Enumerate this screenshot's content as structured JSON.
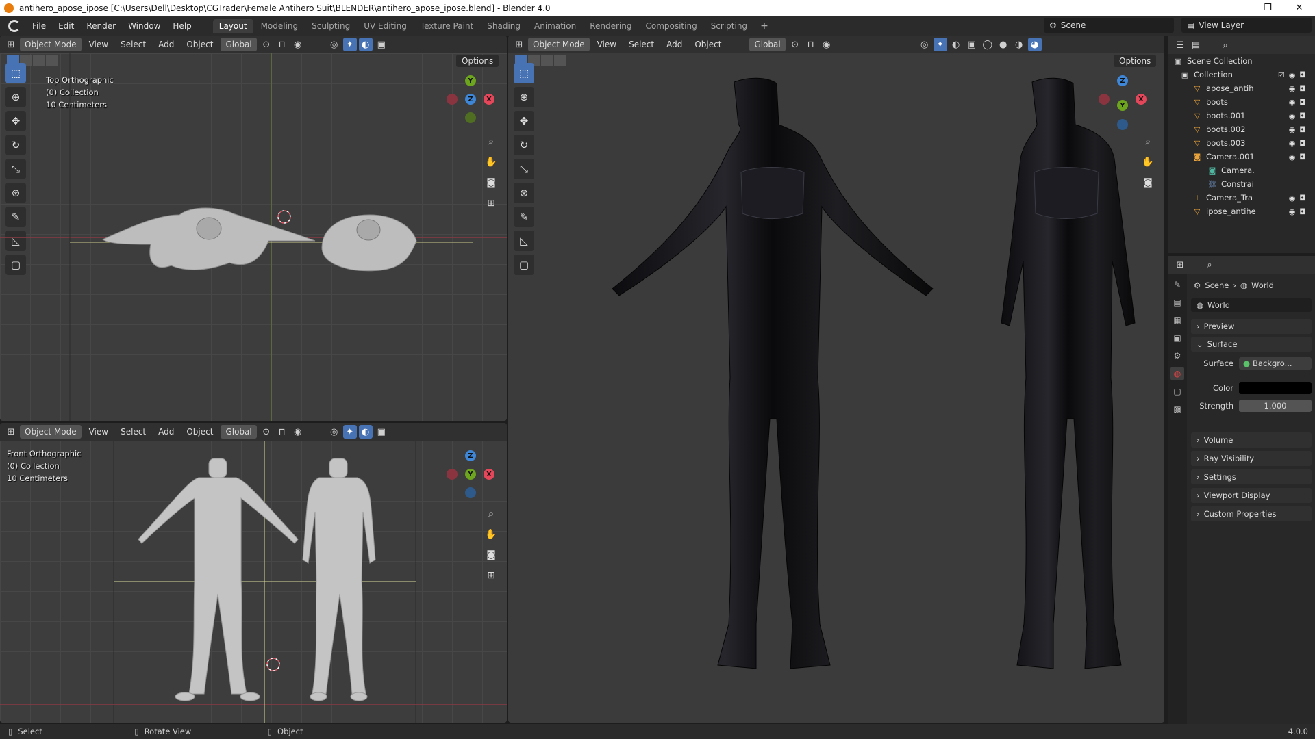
{
  "window": {
    "title": "antihero_apose_ipose [C:\\Users\\Dell\\Desktop\\CGTrader\\Female Antihero Suit\\BLENDER\\antihero_apose_ipose.blend] - Blender 4.0",
    "minimize": "—",
    "maximize": "❐",
    "close": "✕"
  },
  "menu": [
    "File",
    "Edit",
    "Render",
    "Window",
    "Help"
  ],
  "workspaces": [
    "Layout",
    "Modeling",
    "Sculpting",
    "UV Editing",
    "Texture Paint",
    "Shading",
    "Animation",
    "Rendering",
    "Compositing",
    "Scripting"
  ],
  "active_workspace": "Layout",
  "workspace_add": "+",
  "scene": "Scene",
  "view_layer": "View Layer",
  "viewport_header": {
    "mode": "Object Mode",
    "view": "View",
    "select": "Select",
    "add": "Add",
    "object": "Object",
    "orientation": "Global",
    "options": "Options"
  },
  "viewports": {
    "top": {
      "view_name": "Top Orthographic",
      "collection": "(0) Collection",
      "scale": "10 Centimeters"
    },
    "front": {
      "view_name": "Front Orthographic",
      "collection": "(0) Collection",
      "scale": "10 Centimeters"
    }
  },
  "gizmo_labels": {
    "x": "X",
    "y": "Y",
    "z": "Z"
  },
  "outliner": {
    "root": "Scene Collection",
    "items": [
      {
        "name": "Collection",
        "icon": "collection-icon"
      },
      {
        "name": "apose_antih",
        "icon": "mesh-icon"
      },
      {
        "name": "boots",
        "icon": "mesh-icon"
      },
      {
        "name": "boots.001",
        "icon": "mesh-icon"
      },
      {
        "name": "boots.002",
        "icon": "mesh-icon"
      },
      {
        "name": "boots.003",
        "icon": "mesh-icon"
      },
      {
        "name": "Camera.001",
        "icon": "camera-icon"
      },
      {
        "name": "Camera.",
        "icon": "camera-data-icon"
      },
      {
        "name": "Constrai",
        "icon": "constraint-icon"
      },
      {
        "name": "Camera_Tra",
        "icon": "empty-icon"
      },
      {
        "name": "ipose_antihe",
        "icon": "mesh-icon"
      }
    ]
  },
  "properties": {
    "breadcrumb_scene": "Scene",
    "breadcrumb_world": "World",
    "datablock": "World",
    "panels": {
      "preview": "Preview",
      "surface": "Surface",
      "volume": "Volume",
      "ray_visibility": "Ray Visibility",
      "settings": "Settings",
      "viewport_display": "Viewport Display",
      "custom_properties": "Custom Properties"
    },
    "surface_label": "Surface",
    "surface_value": "Backgro...",
    "color_label": "Color",
    "color_value": "#000000",
    "strength_label": "Strength",
    "strength_value": "1.000"
  },
  "statusbar": {
    "select": "Select",
    "rotate": "Rotate View",
    "object": "Object",
    "version": "4.0.0"
  },
  "colors": {
    "accent": "#4772b3",
    "axis_x": "#e4465a",
    "axis_y": "#6ea51e",
    "axis_z": "#3e87d8"
  }
}
